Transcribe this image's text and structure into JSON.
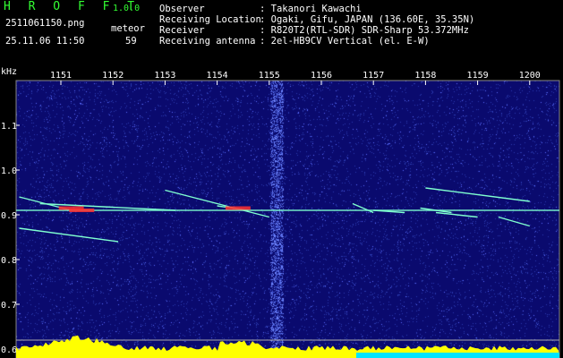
{
  "app": {
    "name": "H R O F F T",
    "version": "1.0.0"
  },
  "file_name": "2511061150.png",
  "datetime": "25.11.06 11:50",
  "meteor": {
    "label": "meteor",
    "count": "59"
  },
  "info": [
    {
      "key": "Observer",
      "value": ": Takanori Kawachi"
    },
    {
      "key": "Receiving Location",
      "value": ": Ogaki, Gifu, JAPAN (136.60E, 35.35N)"
    },
    {
      "key": "Receiver",
      "value": ": R820T2(RTL-SDR) SDR-Sharp 53.372MHz"
    },
    {
      "key": "Receiving antenna",
      "value": ": 2el-HB9CV Vertical (el. E-W)"
    }
  ],
  "chart_data": {
    "type": "heatmap",
    "title": "",
    "xlabel": "",
    "ylabel": "kHz",
    "x_ticks": [
      "1151",
      "1152",
      "1153",
      "1154",
      "1155",
      "1156",
      "1157",
      "1158",
      "1159",
      "1200"
    ],
    "y_ticks": [
      "1.1",
      "1.0",
      "0.9",
      "0.8",
      "0.7",
      "0.6"
    ],
    "ylim": [
      0.58,
      1.2
    ],
    "carrier_khz": 0.91,
    "echoes": [
      {
        "t0": "1150.2",
        "f0": 0.94,
        "t1": "1151.2",
        "f1": 0.91
      },
      {
        "t0": "1150.2",
        "f0": 0.87,
        "t1": "1152.1",
        "f1": 0.84
      },
      {
        "t0": "1150.6",
        "f0": 0.925,
        "t1": "1153.2",
        "f1": 0.91
      },
      {
        "t0": "1153.0",
        "f0": 0.955,
        "t1": "1155.0",
        "f1": 0.895
      },
      {
        "t0": "1154.0",
        "f0": 0.92,
        "t1": "1154.6",
        "f1": 0.91
      },
      {
        "t0": "1156.6",
        "f0": 0.925,
        "t1": "1157.0",
        "f1": 0.905
      },
      {
        "t0": "1157.0",
        "f0": 0.91,
        "t1": "1157.6",
        "f1": 0.905
      },
      {
        "t0": "1158.0",
        "f0": 0.96,
        "t1": "1200",
        "f1": 0.93
      },
      {
        "t0": "1157.9",
        "f0": 0.915,
        "t1": "1158.5",
        "f1": 0.905
      },
      {
        "t0": "1158.2",
        "f0": 0.905,
        "t1": "1159.0",
        "f1": 0.895
      },
      {
        "t0": "1159.4",
        "f0": 0.895,
        "t1": "1200",
        "f1": 0.875
      }
    ],
    "colors": {
      "background": "#0a0a6e",
      "noise": "#2b3ab0",
      "echo": "#7fffd0",
      "hot": "#ff3030",
      "yellow": "#ffff00",
      "cyan": "#00e5ff"
    }
  }
}
